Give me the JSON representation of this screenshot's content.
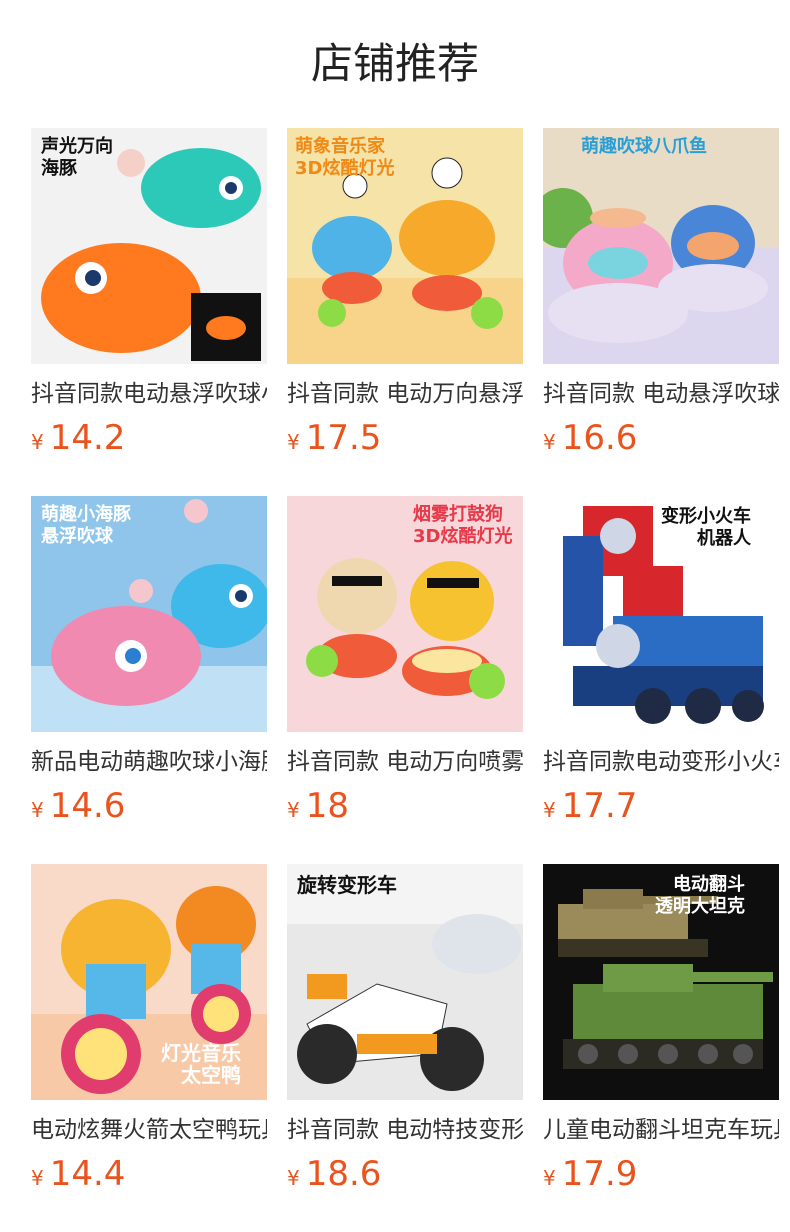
{
  "section_title": "店铺推荐",
  "colors": {
    "price": "#e9541e",
    "title": "#222222",
    "product_name": "#333333"
  },
  "currency_symbol": "¥",
  "products": [
    {
      "name": "抖音同款电动悬浮吹球小海豚",
      "price": "14.2",
      "badge": "声光万向\n海豚",
      "icon": "dolphin-toy-image"
    },
    {
      "name": "抖音同款 电动万向悬浮吹球小象",
      "price": "17.5",
      "badge": "萌象音乐家\n3D炫酷灯光",
      "icon": "elephant-toy-image"
    },
    {
      "name": "抖音同款 电动悬浮吹球八爪鱼",
      "price": "16.6",
      "badge": "萌趣吹球八爪鱼",
      "icon": "octopus-toy-image"
    },
    {
      "name": "新品电动萌趣吹球小海豚",
      "price": "14.6",
      "badge": "萌趣小海豚\n悬浮吹球",
      "icon": "pink-dolphin-toy-image"
    },
    {
      "name": "抖音同款 电动万向喷雾打鼓狗",
      "price": "18",
      "badge": "烟雾打鼓狗\n3D炫酷灯光",
      "icon": "drum-dog-toy-image"
    },
    {
      "name": "抖音同款电动变形小火车机器人",
      "price": "17.7",
      "badge": "变形小火车\n机器人",
      "icon": "train-robot-toy-image"
    },
    {
      "name": "电动炫舞火箭太空鸭玩具",
      "price": "14.4",
      "badge": "灯光音乐\n太空鸭",
      "icon": "space-duck-toy-image"
    },
    {
      "name": "抖音同款 电动特技变形摩托车",
      "price": "18.6",
      "badge": "旋转变形车",
      "icon": "motorcycle-toy-image"
    },
    {
      "name": "儿童电动翻斗坦克车玩具",
      "price": "17.9",
      "badge": "电动翻斗\n透明大坦克",
      "icon": "tank-toy-image"
    }
  ]
}
